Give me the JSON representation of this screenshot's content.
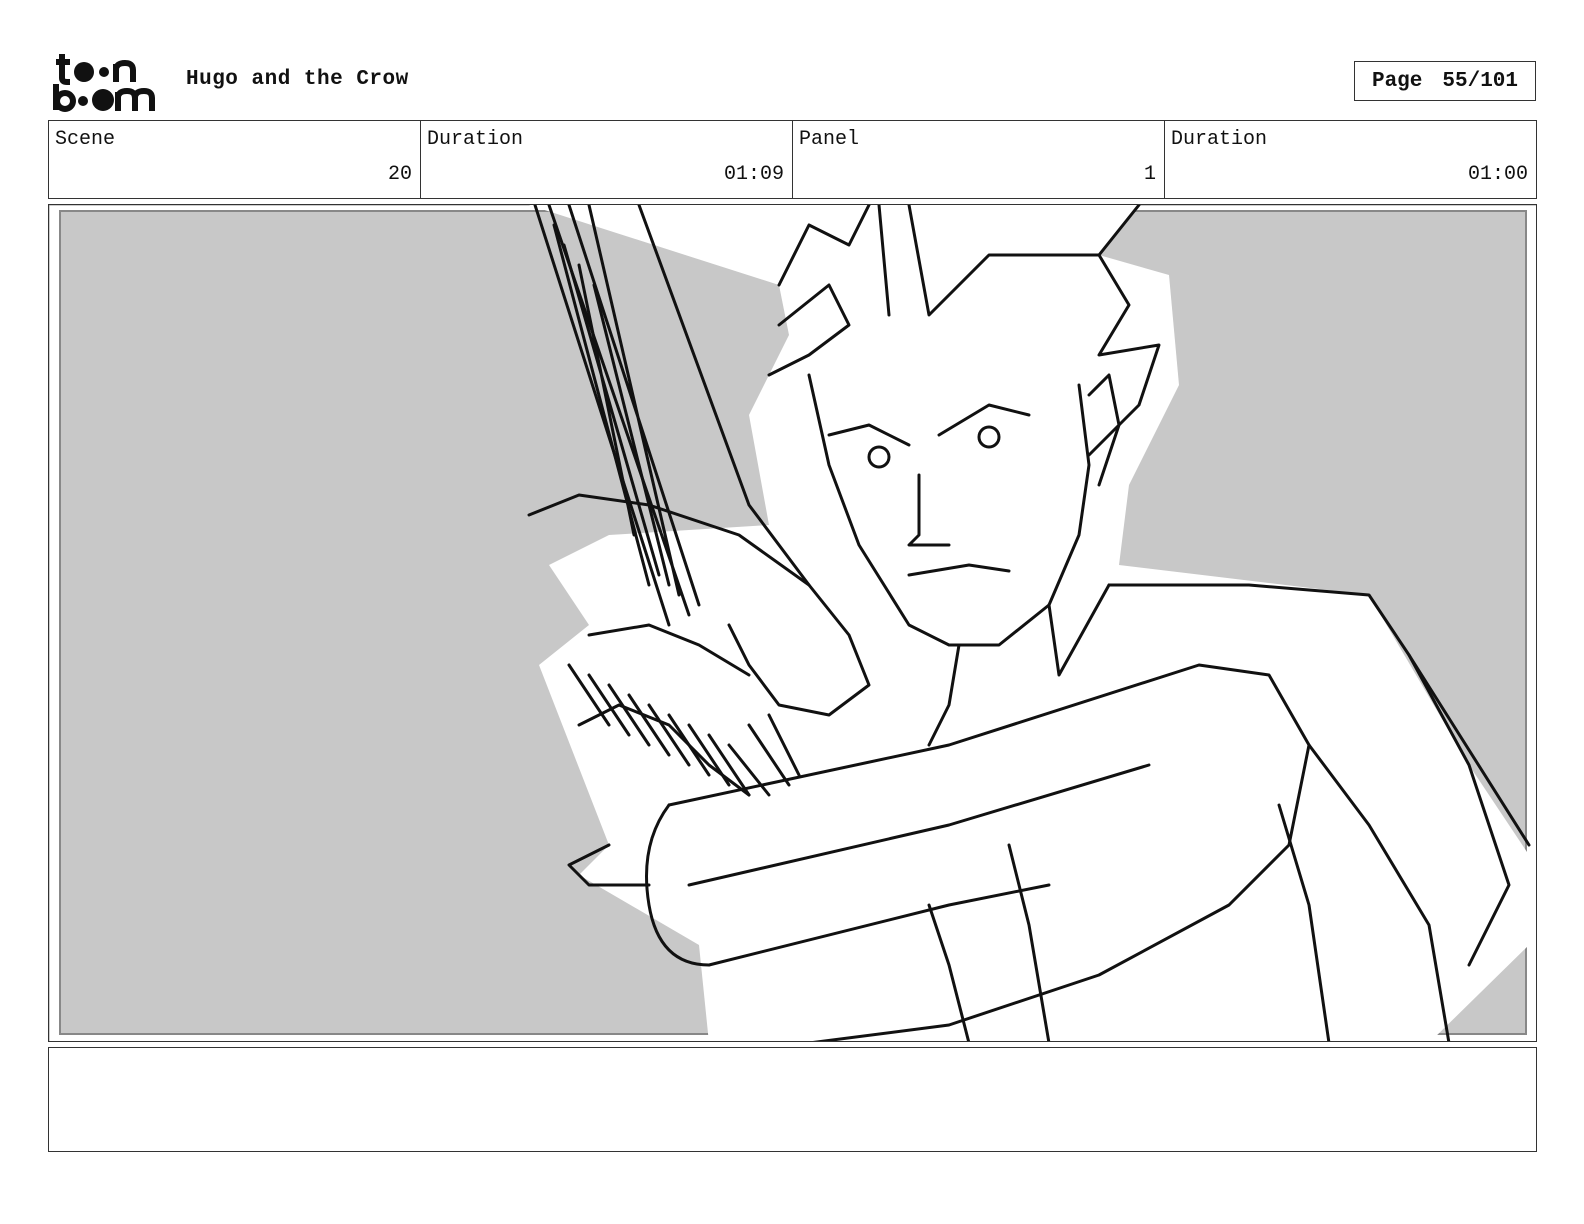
{
  "header": {
    "logo_text": "toon boom",
    "title": "Hugo and the Crow",
    "page_label": "Page",
    "page_value": "55/101"
  },
  "info": [
    {
      "label": "Scene",
      "value": "20"
    },
    {
      "label": "Duration",
      "value": "01:09"
    },
    {
      "label": "Panel",
      "value": "1"
    },
    {
      "label": "Duration",
      "value": "01:00"
    }
  ],
  "panel": {
    "description": "",
    "background_color": "#c8c8c8"
  },
  "notes": {
    "text": ""
  }
}
